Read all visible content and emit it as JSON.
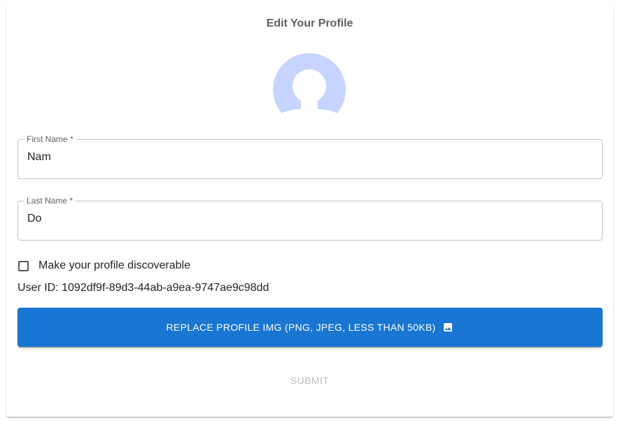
{
  "form": {
    "title": "Edit Your Profile",
    "first_name": {
      "label": "First Name *",
      "value": "Nam"
    },
    "last_name": {
      "label": "Last Name *",
      "value": "Do"
    },
    "discoverable": {
      "label": "Make your profile discoverable",
      "checked": false
    },
    "user_id": "User ID: 1092df9f-89d3-44ab-a9ea-9747ae9c98dd",
    "upload_button": "REPLACE PROFILE IMG (PNG, JPEG, LESS THAN 50KB)",
    "submit_button": "SUBMIT"
  },
  "icons": {
    "avatar": "person-placeholder-icon",
    "upload": "image-icon"
  },
  "colors": {
    "primary": "#1976d2",
    "avatar": "#c6d4ff",
    "disabled": "#bdbdbd"
  }
}
